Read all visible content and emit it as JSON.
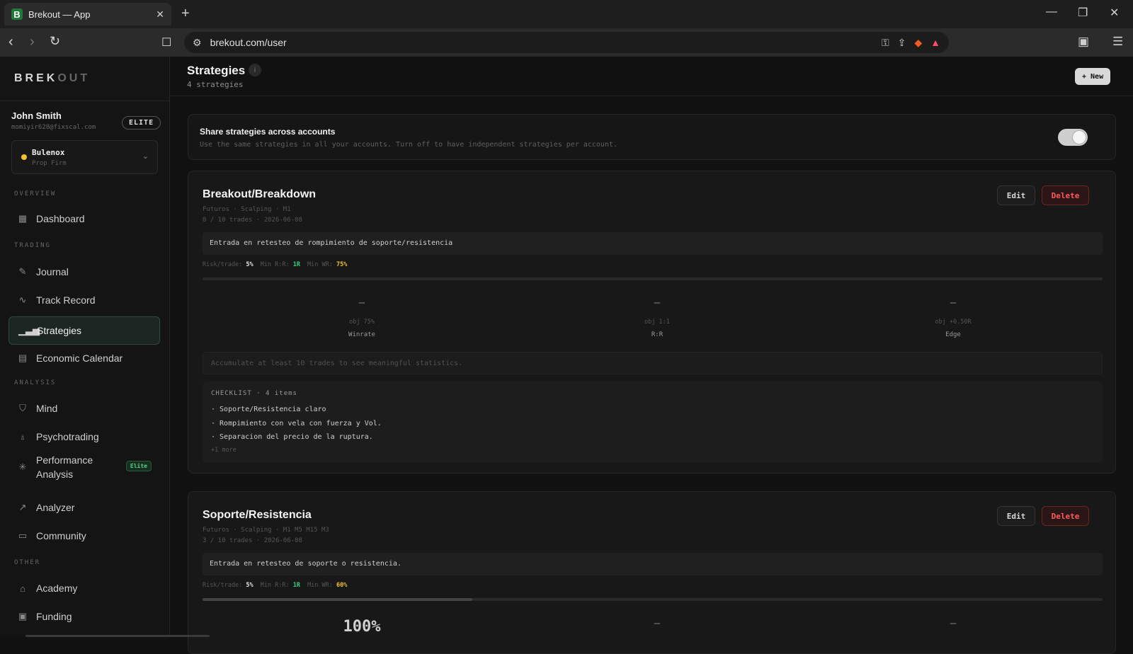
{
  "browser": {
    "tab_title": "Brekout — App",
    "tab_favicon": "B",
    "tab_close": "✕",
    "new_tab": "+",
    "url": "brekout.com/user"
  },
  "sidebar": {
    "brand_main": "BREK",
    "brand_dim": "OUT",
    "user_name": "John Smith",
    "user_email": "momiyir628@fixscal.com",
    "user_badge": "ELITE",
    "account_name": "Bulenox",
    "account_type": "Prop Firm",
    "sections": {
      "overview": "OVERVIEW",
      "trading": "TRADING",
      "analysis": "ANALYSIS",
      "other": "OTHER"
    },
    "items": [
      {
        "label": "Dashboard",
        "icon": "grid-icon"
      },
      {
        "label": "Journal",
        "icon": "pencil-icon"
      },
      {
        "label": "Track Record",
        "icon": "activity-icon"
      },
      {
        "label": "Strategies",
        "icon": "bar-chart-icon",
        "active": true
      },
      {
        "label": "Economic Calendar",
        "icon": "calendar-icon"
      },
      {
        "label": "Mind",
        "icon": "shield-icon"
      },
      {
        "label": "Psychotrading",
        "icon": "lightbulb-icon"
      },
      {
        "label": "Performance Analysis",
        "icon": "sun-icon",
        "badge": "Elite"
      },
      {
        "label": "Analyzer",
        "icon": "trend-icon"
      },
      {
        "label": "Community",
        "icon": "chat-icon"
      },
      {
        "label": "Academy",
        "icon": "graduation-cap-icon"
      },
      {
        "label": "Funding",
        "icon": "briefcase-icon"
      }
    ]
  },
  "header": {
    "title": "Strategies",
    "info": "i",
    "count": "4 strategies",
    "new_button": "+ New"
  },
  "share": {
    "title": "Share strategies across accounts",
    "description": "Use the same strategies in all your accounts. Turn off to have independent strategies per account.",
    "enabled": true
  },
  "strategies": [
    {
      "name": "Breakout/Breakdown",
      "tags": "Futuros · Scalping · M1",
      "stats": "0 / 10 trades · 2026-06-08",
      "description": "Entrada en retesteo de rompimiento de soporte/resistencia",
      "risk_label": "Risk/trade:",
      "risk_value": "5%",
      "rr_label": "Min R:R:",
      "rr_value": "1R",
      "wr_label": "Min WR:",
      "wr_value": "75%",
      "progress": 0,
      "metrics": [
        {
          "value": "—",
          "objective": "obj 75%",
          "label": "Winrate"
        },
        {
          "value": "—",
          "objective": "obj 1:1",
          "label": "R:R"
        },
        {
          "value": "—",
          "objective": "obj +0.50R",
          "label": "Edge"
        }
      ],
      "notice": "Accumulate at least 10 trades to see meaningful statistics.",
      "checklist_title": "CHECKLIST · 4 items",
      "checklist": [
        "· Soporte/Resistencia claro",
        "· Rompimiento con vela con fuerza y Vol.",
        "· Separacion del precio de la ruptura."
      ],
      "more": "+1 more",
      "edit_label": "Edit",
      "delete_label": "Delete"
    },
    {
      "name": "Soporte/Resistencia",
      "tags": "Futuros · Scalping · M1 M5 M15 M3",
      "stats": "3 / 10 trades · 2026-06-08",
      "description": "Entrada en retesteo de soporte o resistencia.",
      "risk_label": "Risk/trade:",
      "risk_value": "5%",
      "rr_label": "Min R:R:",
      "rr_value": "1R",
      "wr_label": "Min WR:",
      "wr_value": "60%",
      "progress": 0.3,
      "metrics": [
        {
          "value": "100%"
        },
        {
          "value": "—"
        },
        {
          "value": "—"
        }
      ],
      "edit_label": "Edit",
      "delete_label": "Delete"
    }
  ]
}
